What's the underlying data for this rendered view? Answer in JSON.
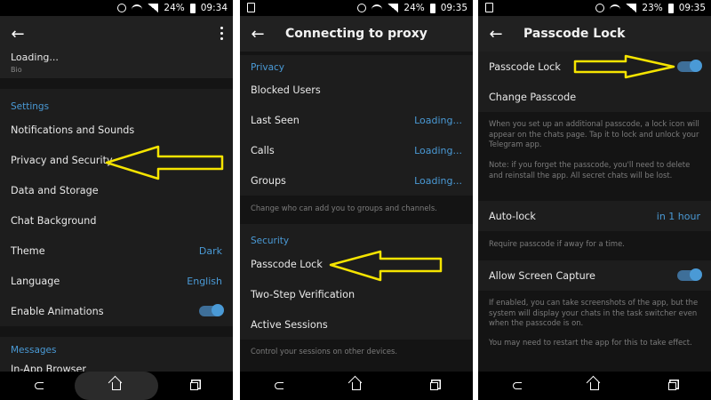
{
  "status": {
    "p1": {
      "battery": "24%",
      "time": "09:34"
    },
    "p2": {
      "battery": "24%",
      "time": "09:35"
    },
    "p3": {
      "battery": "23%",
      "time": "09:35"
    }
  },
  "screen1": {
    "profile": {
      "loading": "Loading...",
      "bio_label": "Bio"
    },
    "settings_title": "Settings",
    "items": [
      {
        "label": "Notifications and Sounds",
        "value": ""
      },
      {
        "label": "Privacy and Security",
        "value": ""
      },
      {
        "label": "Data and Storage",
        "value": ""
      },
      {
        "label": "Chat Background",
        "value": ""
      },
      {
        "label": "Theme",
        "value": "Dark"
      },
      {
        "label": "Language",
        "value": "English"
      },
      {
        "label": "Enable Animations",
        "value": ""
      }
    ],
    "messages_title": "Messages",
    "partial_item": "In-App Browser"
  },
  "screen2": {
    "title": "Connecting to proxy",
    "privacy_title": "Privacy",
    "privacy_items": [
      {
        "label": "Blocked Users",
        "value": ""
      },
      {
        "label": "Last Seen",
        "value": "Loading..."
      },
      {
        "label": "Calls",
        "value": "Loading..."
      },
      {
        "label": "Groups",
        "value": "Loading..."
      }
    ],
    "privacy_note": "Change who can add you to groups and channels.",
    "security_title": "Security",
    "security_items": [
      {
        "label": "Passcode Lock"
      },
      {
        "label": "Two-Step Verification"
      },
      {
        "label": "Active Sessions"
      }
    ],
    "security_note": "Control your sessions on other devices."
  },
  "screen3": {
    "title": "Passcode Lock",
    "passcode_lock_label": "Passcode Lock",
    "change_passcode_label": "Change Passcode",
    "note1": "When you set up an additional passcode, a lock icon will appear on the chats page. Tap it to lock and unlock your Telegram app.",
    "note2": "Note: if you forget the passcode, you'll need to delete and reinstall the app. All secret chats will be lost.",
    "autolock_label": "Auto-lock",
    "autolock_value": "in 1 hour",
    "autolock_note": "Require passcode if away for a time.",
    "screen_capture_label": "Allow Screen Capture",
    "note3": "If enabled, you can take screenshots of the app, but the system will display your chats in the task switcher even when the passcode is on.",
    "note4": "You may need to restart the app for this to take effect."
  },
  "toggles": {
    "enable_animations": true,
    "passcode_lock": true,
    "allow_screen_capture": true
  },
  "colors": {
    "accent": "#4a9ad6",
    "background": "#1d1d1d",
    "arrow": "#f5e400"
  }
}
